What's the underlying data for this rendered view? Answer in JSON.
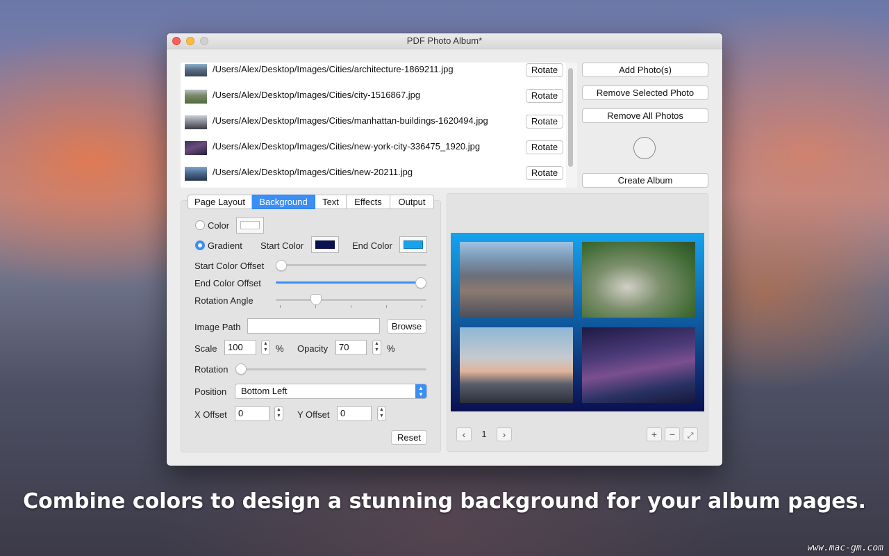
{
  "window": {
    "title": "PDF Photo Album*"
  },
  "photos": [
    {
      "path": "/Users/Alex/Desktop/Images/Cities/architecture-1869211.jpg",
      "rotate_label": "Rotate"
    },
    {
      "path": "/Users/Alex/Desktop/Images/Cities/city-1516867.jpg",
      "rotate_label": "Rotate"
    },
    {
      "path": "/Users/Alex/Desktop/Images/Cities/manhattan-buildings-1620494.jpg",
      "rotate_label": "Rotate"
    },
    {
      "path": "/Users/Alex/Desktop/Images/Cities/new-york-city-336475_1920.jpg",
      "rotate_label": "Rotate"
    },
    {
      "path": "/Users/Alex/Desktop/Images/Cities/new-20211.jpg",
      "rotate_label": "Rotate"
    }
  ],
  "actions": {
    "add": "Add Photo(s)",
    "remove_selected": "Remove Selected Photo",
    "remove_all": "Remove All Photos",
    "create": "Create Album"
  },
  "tabs": [
    {
      "label": "Page Layout",
      "active": false
    },
    {
      "label": "Background",
      "active": true
    },
    {
      "label": "Text",
      "active": false
    },
    {
      "label": "Effects",
      "active": false
    },
    {
      "label": "Output",
      "active": false
    }
  ],
  "background": {
    "color_label": "Color",
    "color_value": "#ffffff",
    "gradient_label": "Gradient",
    "mode": "gradient",
    "start_color_label": "Start Color",
    "start_color": "#0b1050",
    "end_color_label": "End Color",
    "end_color": "#15a3ee",
    "start_offset_label": "Start Color Offset",
    "start_offset": 0.0,
    "end_offset_label": "End Color Offset",
    "end_offset": 1.0,
    "rotation_angle_label": "Rotation Angle",
    "rotation_angle": 0.25,
    "image_path_label": "Image Path",
    "image_path": "",
    "browse_label": "Browse",
    "scale_label": "Scale",
    "scale": "100",
    "opacity_label": "Opacity",
    "opacity": "70",
    "percent": "%",
    "rotation_label": "Rotation",
    "rotation": 0.0,
    "position_label": "Position",
    "position": "Bottom Left",
    "x_offset_label": "X Offset",
    "x_offset": "0",
    "y_offset_label": "Y Offset",
    "y_offset": "0",
    "reset_label": "Reset"
  },
  "preview": {
    "page_number": "1",
    "prev_icon": "chevron-left-icon",
    "next_icon": "chevron-right-icon",
    "zoom_in_icon": "plus-icon",
    "zoom_out_icon": "minus-icon",
    "fit_icon": "expand-icon"
  },
  "caption": "Combine colors to design a stunning background for your album pages.",
  "watermark": "www.mac-gm.com"
}
